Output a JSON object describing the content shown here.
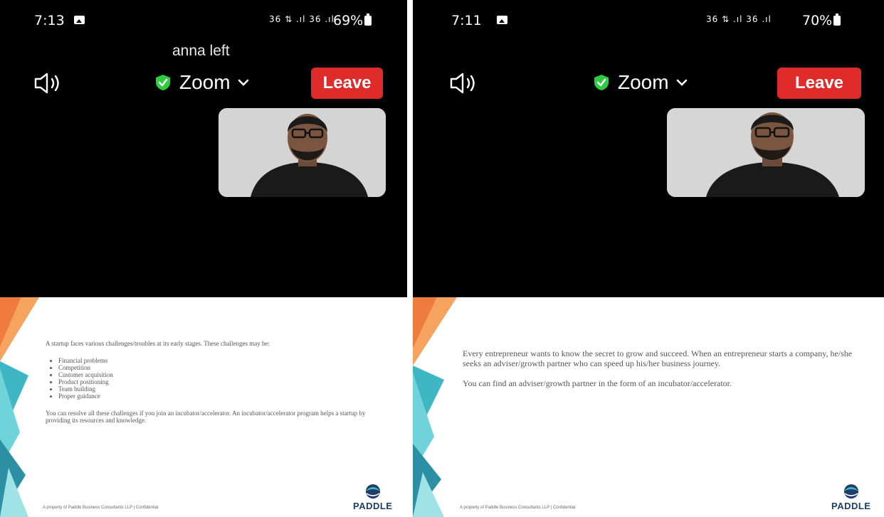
{
  "left": {
    "status": {
      "time": "7:13",
      "signal": "36 ⇅ .ıl 36 .ıl",
      "battery": "69%"
    },
    "notice": "anna left",
    "header": {
      "title": "Zoom",
      "leave_label": "Leave"
    },
    "slide": {
      "intro": "A startup faces various challenges/troubles at its early stages. These challenges may be:",
      "items": [
        "Financial problems",
        "Competition",
        "Customer acquisition",
        "Product positioning",
        "Team building",
        "Proper guidance"
      ],
      "outro": "You can resolve all these challenges if you join an incubator/accelerator. An incubator/accelerator program helps a startup by providing its resources and knowledge.",
      "footer": "A property of Paddle Business Consultants LLP | Confidential",
      "logo": "PADDLE"
    }
  },
  "right": {
    "status": {
      "time": "7:11",
      "signal": "36 ⇅ .ıl 36 .ıl",
      "battery": "70%"
    },
    "header": {
      "title": "Zoom",
      "leave_label": "Leave"
    },
    "slide": {
      "para1": "Every entrepreneur wants to know the secret to grow and succeed. When an entrepreneur starts a company, he/she seeks an adviser/growth partner who can speed up his/her business journey.",
      "para2": "You can find an adviser/growth partner in the form of an incubator/accelerator.",
      "footer": "A property of Paddle Business Consultants LLP | Confidential",
      "logo": "PADDLE"
    }
  },
  "colors": {
    "leave": "#e02b2b",
    "shield": "#2ecc40",
    "slide_teal": "#3fb6c4",
    "slide_orange": "#f07b3f",
    "logo_blue": "#1e3d6b"
  }
}
